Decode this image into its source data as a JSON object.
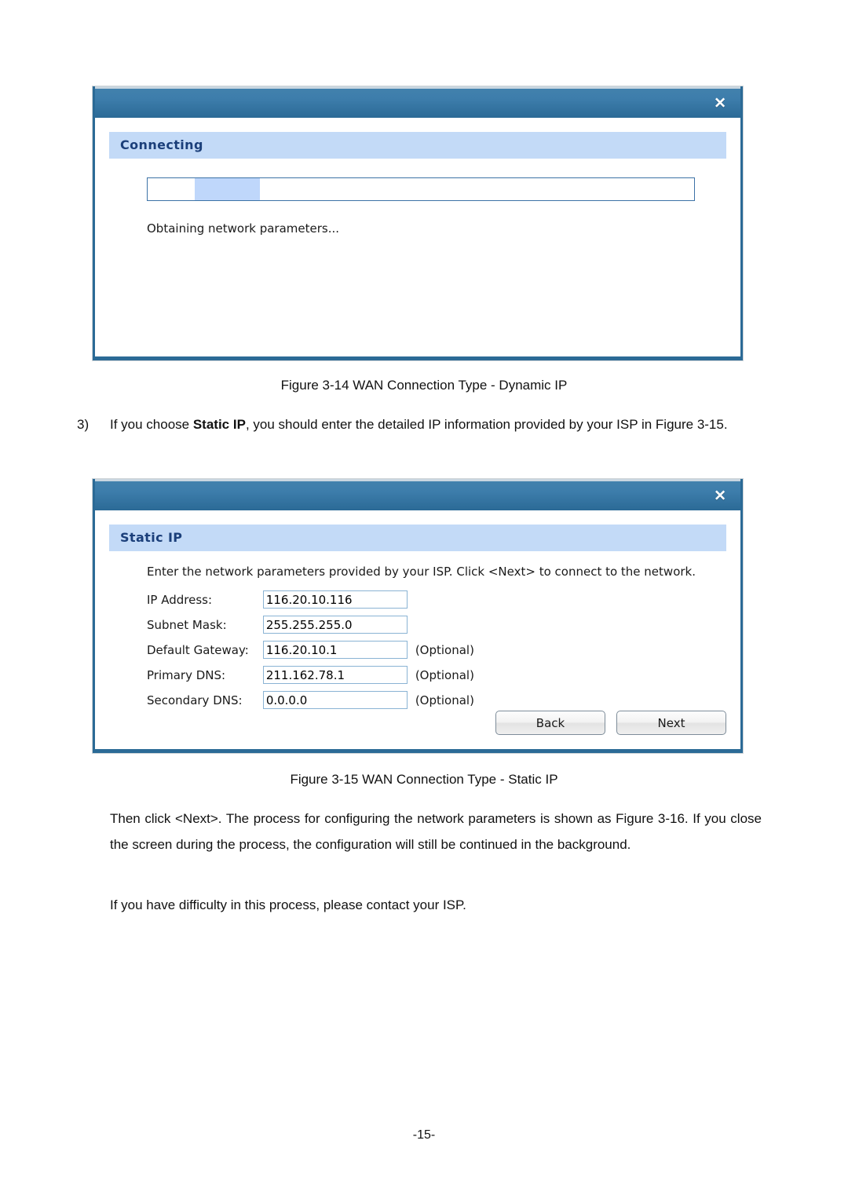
{
  "document": {
    "page_number": "-15-",
    "figure_14_caption": "Figure 3-14 WAN Connection Type - Dynamic IP",
    "figure_15_caption": "Figure 3-15 WAN Connection Type - Static IP",
    "step_3": {
      "marker": "3)",
      "text_before_bold": "If you choose ",
      "bold_text": "Static IP",
      "text_after_bold": ", you should enter the detailed IP information provided by your ISP in Figure 3-15."
    },
    "paragraph_1": "Then click <Next>. The process for configuring the network parameters is shown as Figure 3-16. If you close the screen during the process, the configuration will still be continued in the background.",
    "paragraph_2": "If you have difficulty in this process, please contact your ISP."
  },
  "dialog_connecting": {
    "close_label": "✕",
    "section_title": "Connecting",
    "status_text": "Obtaining network parameters...",
    "progress": {
      "indeterminate": true,
      "chunk_start_percent": 8.6,
      "chunk_width_percent": 12
    }
  },
  "dialog_static_ip": {
    "close_label": "✕",
    "section_title": "Static IP",
    "intro_text": "Enter the network parameters provided by your ISP. Click <Next> to connect to the network.",
    "fields": [
      {
        "label": "IP Address:",
        "value": "116.20.10.116",
        "note": ""
      },
      {
        "label": "Subnet Mask:",
        "value": "255.255.255.0",
        "note": ""
      },
      {
        "label": "Default Gateway:",
        "value": "116.20.10.1",
        "note": "(Optional)"
      },
      {
        "label": "Primary DNS:",
        "value": "211.162.78.1",
        "note": "(Optional)"
      },
      {
        "label": "Secondary DNS:",
        "value": "0.0.0.0",
        "note": "(Optional)"
      }
    ],
    "buttons": {
      "back_label": "Back",
      "next_label": "Next"
    }
  },
  "colors": {
    "titlebar_top": "#4281ad",
    "titlebar_bottom": "#2b6a96",
    "section_header_bg": "#c3daf7",
    "section_header_text": "#1b3f7a",
    "progress_chunk": "#bfd7fb",
    "input_border": "#8ab3d4",
    "dialog_border": "#2b6a96"
  }
}
